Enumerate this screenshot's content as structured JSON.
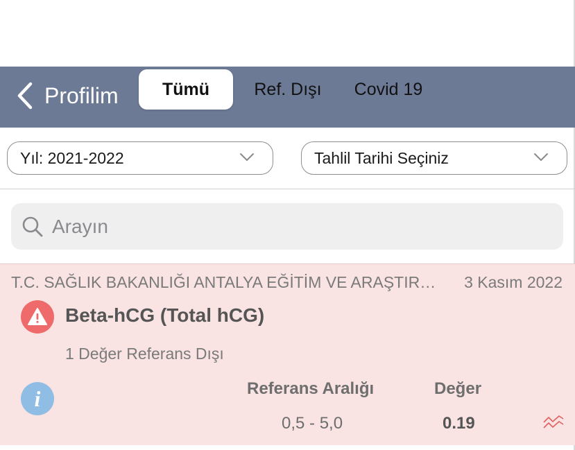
{
  "navbar": {
    "back_label": "Profilim",
    "tabs": [
      {
        "label": "Tümü",
        "active": true
      },
      {
        "label": "Ref. Dışı",
        "active": false
      },
      {
        "label": "Covid 19",
        "active": false
      }
    ],
    "background_color": "#6c7a96"
  },
  "filters": {
    "year": {
      "value": "Yıl: 2021-2022"
    },
    "date": {
      "value": "Tahlil Tarihi Seçiniz"
    }
  },
  "search": {
    "placeholder": "Arayın"
  },
  "results": [
    {
      "institution": "T.C. SAĞLIK BAKANLIĞI ANTALYA EĞİTİM VE ARAŞTIRMA HASTANESİ",
      "date": "3 Kasım 2022",
      "test_name": "Beta-hCG (Total hCG)",
      "out_of_range_text": "1 Değer Referans Dışı",
      "reference_header": "Referans Aralığı",
      "value_header": "Değer",
      "reference_range": "0,5 - 5,0",
      "value": "0.19",
      "status_color": "#ef6a6a",
      "icons": [
        "warning-icon",
        "info-icon",
        "trend-chart-icon"
      ]
    }
  ]
}
